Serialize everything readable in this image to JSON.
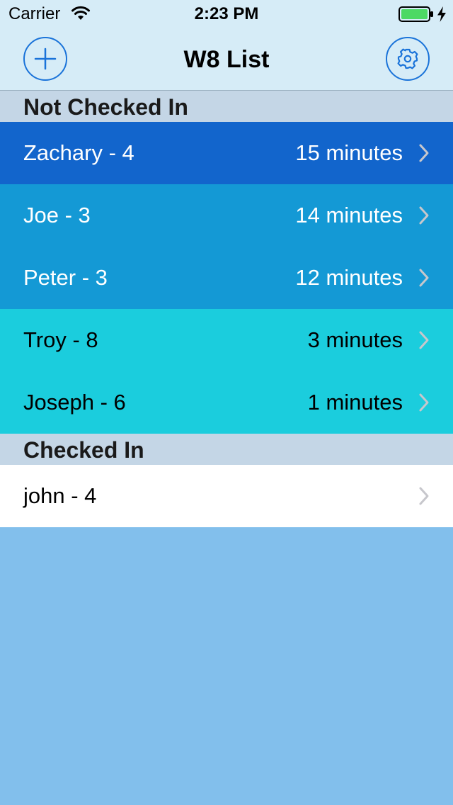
{
  "status": {
    "carrier": "Carrier",
    "time": "2:23 PM",
    "battery_color": "#4cd964"
  },
  "nav": {
    "title": "W8 List",
    "add_icon": "plus-icon",
    "settings_icon": "gear-icon",
    "accent": "#1a73d9"
  },
  "sections": {
    "not_checked_in": {
      "title": "Not Checked In",
      "rows": [
        {
          "name": "Zachary - 4",
          "wait": "15 minutes",
          "color": "#1265cc",
          "text": "light"
        },
        {
          "name": "Joe - 3",
          "wait": "14 minutes",
          "color": "#1499d5",
          "text": "light"
        },
        {
          "name": "Peter - 3",
          "wait": "12 minutes",
          "color": "#1499d5",
          "text": "light"
        },
        {
          "name": "Troy - 8",
          "wait": "3 minutes",
          "color": "#1bcddd",
          "text": "dark"
        },
        {
          "name": "Joseph - 6",
          "wait": "1 minutes",
          "color": "#1bcddd",
          "text": "dark"
        }
      ]
    },
    "checked_in": {
      "title": "Checked In",
      "rows": [
        {
          "name": "john - 4",
          "wait": "",
          "color": "#ffffff",
          "text": "dark"
        }
      ]
    }
  }
}
